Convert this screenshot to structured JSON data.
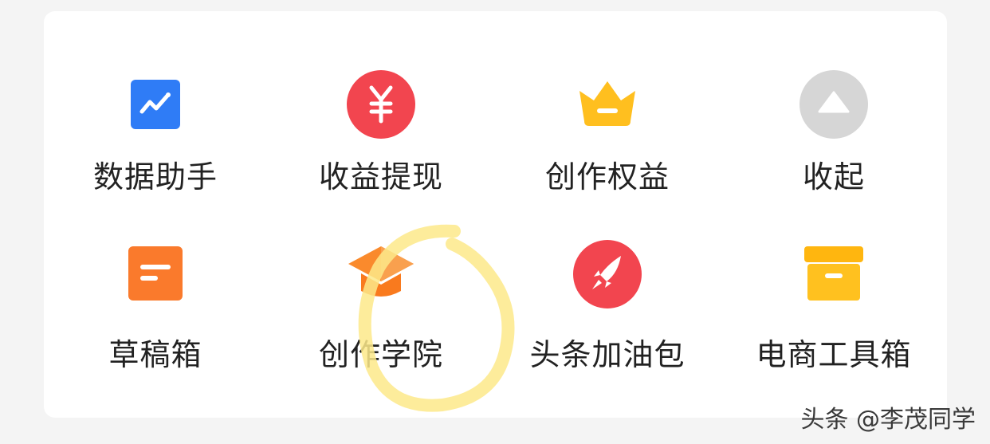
{
  "grid": {
    "items": [
      {
        "label": "数据助手",
        "icon": "trend-chart-icon",
        "color": "#2f7cf6"
      },
      {
        "label": "收益提现",
        "icon": "yuan-icon",
        "color": "#f2454f"
      },
      {
        "label": "创作权益",
        "icon": "crown-icon",
        "color": "#ffbf1f"
      },
      {
        "label": "收起",
        "icon": "collapse-up-icon",
        "color": "#d6d6d6"
      },
      {
        "label": "草稿箱",
        "icon": "draft-icon",
        "color": "#fa7a2c"
      },
      {
        "label": "创作学院",
        "icon": "graduation-cap-icon",
        "color": "#fa8a2c"
      },
      {
        "label": "头条加油包",
        "icon": "rocket-icon",
        "color": "#f2454f"
      },
      {
        "label": "电商工具箱",
        "icon": "toolbox-icon",
        "color": "#ffc11f"
      }
    ]
  },
  "watermark": {
    "text": "头条 @李茂同学"
  },
  "colors": {
    "highlight": "#fde98a",
    "text": "#222222",
    "background": "#f4f4f4"
  }
}
